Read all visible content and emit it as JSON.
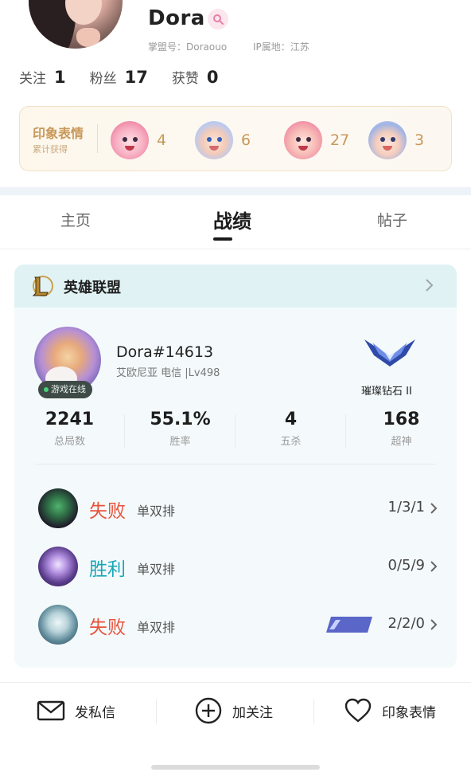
{
  "profile": {
    "nickname": "Dora",
    "league_id": "掌盟号：Doraouo",
    "ip_location": "IP属地：江苏",
    "stats": [
      {
        "label": "关注",
        "value": "1"
      },
      {
        "label": "粉丝",
        "value": "17"
      },
      {
        "label": "获赞",
        "value": "0"
      }
    ]
  },
  "impression": {
    "title": "印象表情",
    "subtitle": "累计获得",
    "emotes": [
      {
        "icon": "pink-girl-emote-icon",
        "count": "4"
      },
      {
        "icon": "waving-boy-emote-icon",
        "count": "6"
      },
      {
        "icon": "excited-girl-emote-icon",
        "count": "27"
      },
      {
        "icon": "gg-helmet-emote-icon",
        "count": "3"
      }
    ]
  },
  "tabs": [
    {
      "label": "主页",
      "active": false
    },
    {
      "label": "战绩",
      "active": true
    },
    {
      "label": "帖子",
      "active": false
    }
  ],
  "game": {
    "name": "英雄联盟",
    "player": {
      "name": "Dora#14613",
      "meta": "艾欧尼亚  电信 |Lv498",
      "online_status": "游戏在线",
      "rank": "璀璨钻石 II"
    },
    "stats": [
      {
        "value": "2241",
        "label": "总局数"
      },
      {
        "value": "55.1%",
        "label": "胜率"
      },
      {
        "value": "4",
        "label": "五杀"
      },
      {
        "value": "168",
        "label": "超神"
      }
    ],
    "matches": [
      {
        "result": "失败",
        "outcome": "lose",
        "mode": "单双排",
        "kda": "1/3/1",
        "svp": false
      },
      {
        "result": "胜利",
        "outcome": "win",
        "mode": "单双排",
        "kda": "0/5/9",
        "svp": false
      },
      {
        "result": "失败",
        "outcome": "lose",
        "mode": "单双排",
        "kda": "2/2/0",
        "svp": true
      }
    ]
  },
  "actions": [
    {
      "label": "发私信",
      "icon": "envelope-icon"
    },
    {
      "label": "加关注",
      "icon": "plus-circle-icon"
    },
    {
      "label": "印象表情",
      "icon": "heart-icon"
    }
  ],
  "colors": {
    "lose": "#e8533c",
    "win": "#18a7b9",
    "impression_gold": "#c8985a",
    "card_bg": "#f4fafb",
    "card_header_bg": "#e1f2f4"
  }
}
